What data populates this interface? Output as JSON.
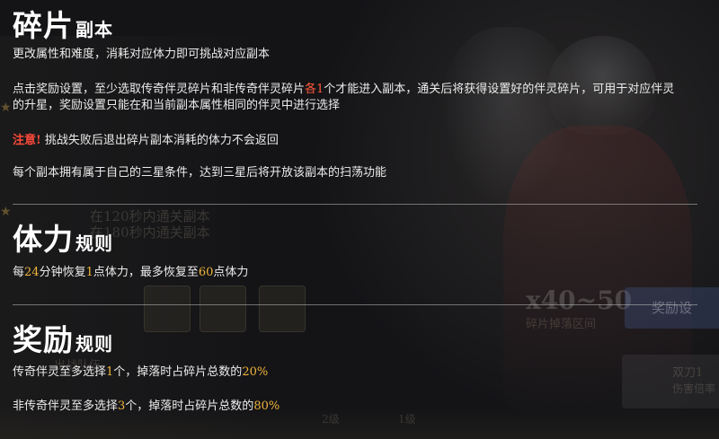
{
  "fragment": {
    "title_main": "碎片",
    "title_sub": "副本",
    "line1": "更改属性和难度，消耗对应体力即可挑战对应副本",
    "line2_a": "点击奖励设置，至少选取传奇伴灵碎片和非传奇伴灵碎片",
    "line2_hl": "各1",
    "line2_b": "个才能进入副本，通关后将获得设置好的伴灵碎片，可用于对应伴灵",
    "line3": "的升星，奖励设置只能在和当前副本属性相同的伴灵中进行选择",
    "warning_label": "注意!",
    "warning_text": "挑战失败后退出碎片副本消耗的体力不会返回",
    "line5": "每个副本拥有属于自己的三星条件，达到三星后将开放该副本的扫荡功能"
  },
  "stamina": {
    "title_main": "体力",
    "title_sub": "规则",
    "t1": "每",
    "n1": "24",
    "t2": "分钟恢复",
    "n2": "1",
    "t3": "点体力，最多恢复至",
    "n3": "60",
    "t4": "点体力"
  },
  "reward": {
    "title_main": "奖励",
    "title_sub": "规则",
    "l1_a": "传奇伴灵至多选择",
    "l1_n": "1",
    "l1_b": "个，掉落时占碎片总数的",
    "l1_p": "20%",
    "l2_a": "非传奇伴灵至多选择",
    "l2_n": "3",
    "l2_b": "个，掉落时占碎片总数的",
    "l2_p": "80%"
  },
  "background": {
    "cond1": "在120秒内通关副本",
    "cond2": "在180秒内通关副本",
    "range": "x40~50",
    "range_label": "碎片掉落区间",
    "button": "奖励设",
    "team": "出战队伍",
    "card_name": "双刀1",
    "card_sub": "伤害倍率",
    "level1": "2级",
    "level2": "1级"
  }
}
